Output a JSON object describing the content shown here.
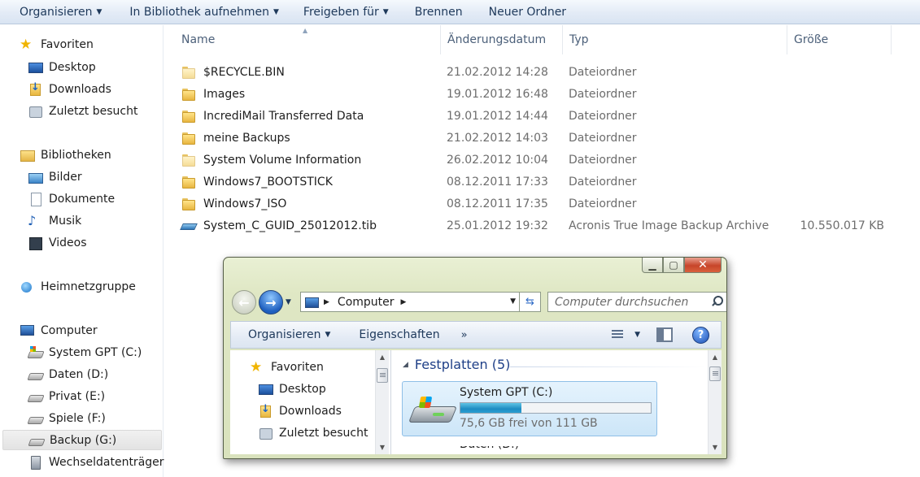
{
  "toolbar": {
    "organize": "Organisieren",
    "include_library": "In Bibliothek aufnehmen",
    "share": "Freigeben für",
    "burn": "Brennen",
    "new_folder": "Neuer Ordner"
  },
  "nav": {
    "favorites": "Favoriten",
    "desktop": "Desktop",
    "downloads": "Downloads",
    "recent": "Zuletzt besucht",
    "libraries": "Bibliotheken",
    "pictures": "Bilder",
    "documents": "Dokumente",
    "music": "Musik",
    "videos": "Videos",
    "homegroup": "Heimnetzgruppe",
    "computer": "Computer",
    "drive_c": "System GPT (C:)",
    "drive_d": "Daten (D:)",
    "drive_e": "Privat (E:)",
    "drive_f": "Spiele (F:)",
    "drive_g": "Backup (G:)",
    "removable": "Wechseldatenträger"
  },
  "columns": {
    "name": "Name",
    "date": "Änderungsdatum",
    "type": "Typ",
    "size": "Größe"
  },
  "files": [
    {
      "name": "$RECYCLE.BIN",
      "date": "21.02.2012 14:28",
      "type": "Dateiordner",
      "size": "",
      "icon": "folder-ghost-icon"
    },
    {
      "name": "Images",
      "date": "19.01.2012 16:48",
      "type": "Dateiordner",
      "size": "",
      "icon": "folder-icon"
    },
    {
      "name": "IncrediMail Transferred Data",
      "date": "19.01.2012 14:44",
      "type": "Dateiordner",
      "size": "",
      "icon": "folder-icon"
    },
    {
      "name": "meine Backups",
      "date": "21.02.2012 14:03",
      "type": "Dateiordner",
      "size": "",
      "icon": "folder-icon"
    },
    {
      "name": "System Volume Information",
      "date": "26.02.2012 10:04",
      "type": "Dateiordner",
      "size": "",
      "icon": "folder-ghost-icon"
    },
    {
      "name": "Windows7_BOOTSTICK",
      "date": "08.12.2011 17:33",
      "type": "Dateiordner",
      "size": "",
      "icon": "folder-icon"
    },
    {
      "name": "Windows7_ISO",
      "date": "08.12.2011 17:35",
      "type": "Dateiordner",
      "size": "",
      "icon": "folder-icon"
    },
    {
      "name": "System_C_GUID_25012012.tib",
      "date": "25.01.2012 19:32",
      "type": "Acronis True Image Backup Archive",
      "size": "10.550.017 KB",
      "icon": "backup-archive-icon"
    }
  ],
  "inner_window": {
    "address_crumb": "Computer",
    "search_placeholder": "Computer durchsuchen",
    "cmd_organize": "Organisieren",
    "cmd_properties": "Eigenschaften",
    "cmd_more": "»",
    "help": "?",
    "nav": {
      "favorites": "Favoriten",
      "desktop": "Desktop",
      "downloads": "Downloads",
      "recent": "Zuletzt besucht"
    },
    "group_title": "Festplatten (5)",
    "drive_name": "System GPT (C:)",
    "drive_free_text": "75,6 GB frei von 111 GB",
    "drive_used_fraction": 0.32,
    "next_item_partial": "Daten (D:)"
  }
}
